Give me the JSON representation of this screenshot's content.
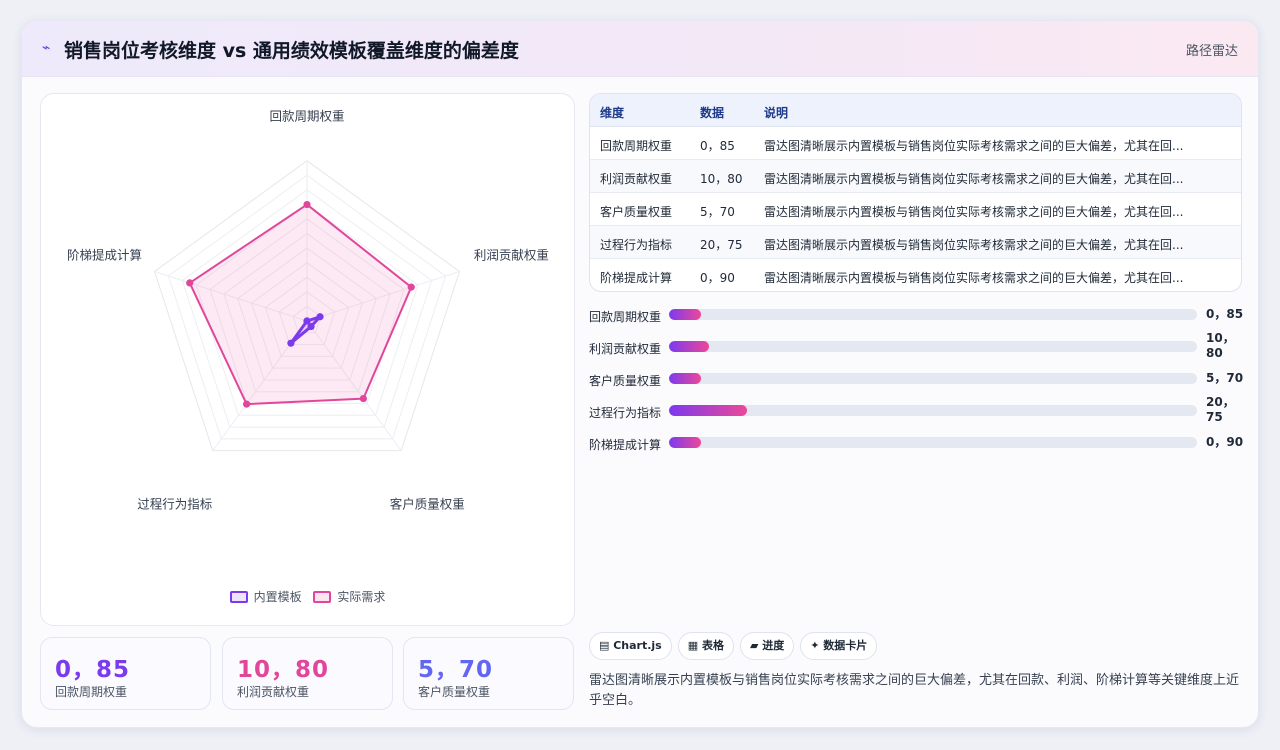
{
  "header": {
    "icon": "lightning-icon",
    "title": "销售岗位考核维度 vs 通用绩效模板覆盖维度的偏差度",
    "tag": "路径雷达"
  },
  "chart_data": {
    "type": "radar",
    "axes": [
      "回款周期权重",
      "利润贡献权重",
      "客户质量权重",
      "过程行为指标",
      "阶梯提成计算"
    ],
    "series": [
      {
        "name": "内置模板",
        "values": [
          0,
          10,
          5,
          20,
          0
        ],
        "color": "#7c3aed"
      },
      {
        "name": "实际需求",
        "values": [
          85,
          80,
          70,
          75,
          90
        ],
        "color": "#e0479b"
      }
    ],
    "rmax": 100,
    "grid_levels": 10
  },
  "legend": {
    "items": [
      "内置模板",
      "实际需求"
    ]
  },
  "kpis": [
    {
      "value": "0，85",
      "label": "回款周期权重",
      "color": "#7c3aed"
    },
    {
      "value": "10，80",
      "label": "利润贡献权重",
      "color": "#e0479b"
    },
    {
      "value": "5，70",
      "label": "客户质量权重",
      "color": "#6366f1"
    }
  ],
  "table": {
    "headers": [
      "维度",
      "数据",
      "说明"
    ],
    "rows": [
      [
        "回款周期权重",
        "0，85",
        "雷达图清晰展示内置模板与销售岗位实际考核需求之间的巨大偏差，尤其在回..."
      ],
      [
        "利润贡献权重",
        "10，80",
        "雷达图清晰展示内置模板与销售岗位实际考核需求之间的巨大偏差，尤其在回..."
      ],
      [
        "客户质量权重",
        "5，70",
        "雷达图清晰展示内置模板与销售岗位实际考核需求之间的巨大偏差，尤其在回..."
      ],
      [
        "过程行为指标",
        "20，75",
        "雷达图清晰展示内置模板与销售岗位实际考核需求之间的巨大偏差，尤其在回..."
      ],
      [
        "阶梯提成计算",
        "0，90",
        "雷达图清晰展示内置模板与销售岗位实际考核需求之间的巨大偏差，尤其在回..."
      ]
    ]
  },
  "progress": [
    {
      "label": "回款周期权重",
      "value": "0，85",
      "fill": 0.06,
      "wrap": false
    },
    {
      "label": "利润贡献权重",
      "value": "10，80",
      "fill": 0.075,
      "wrap": true
    },
    {
      "label": "客户质量权重",
      "value": "5，70",
      "fill": 0.06,
      "wrap": false
    },
    {
      "label": "过程行为指标",
      "value": "20，75",
      "fill": 0.148,
      "wrap": true
    },
    {
      "label": "阶梯提成计算",
      "value": "0，90",
      "fill": 0.06,
      "wrap": false
    }
  ],
  "chips": [
    "▤ Chart.js",
    "▦ 表格",
    "▰ 进度",
    "✦ 数据卡片"
  ],
  "description": "雷达图清晰展示内置模板与销售岗位实际考核需求之间的巨大偏差，尤其在回款、利润、阶梯计算等关键维度上近乎空白。"
}
